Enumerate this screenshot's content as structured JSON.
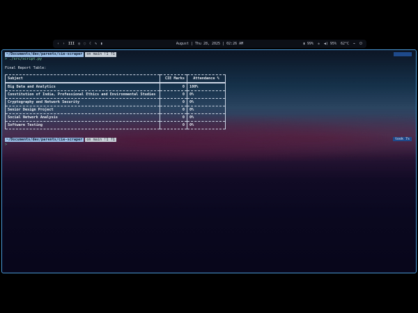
{
  "topbar": {
    "left_items": [
      "‹",
      "›",
      "III",
      "◎",
      "◌",
      "☾",
      "✎",
      "▮"
    ],
    "datetime": "August | Thu 28, 2025 | 02:26 AM",
    "right_items": [
      "▮ 99%",
      "✲",
      "◀) 95%",
      "62°C",
      "⌁",
      "⏻"
    ]
  },
  "terminal": {
    "prompt1": {
      "path": "~/Documents/dev/parents/cie-scraper",
      "git": "on main !1 ?1",
      "arrow": ">",
      "command": "./src/script.py"
    },
    "heading": "Final Report Table:",
    "table": {
      "headers": [
        "Subject",
        "CIE Marks",
        "Attendance %"
      ],
      "rows": [
        [
          "Big Data and Analytics",
          "0",
          "100%"
        ],
        [
          "Constitution of India, Professional Ethics and Environmental Studies",
          "0",
          "0%"
        ],
        [
          "Cryptography and Network Security",
          "0",
          "0%"
        ],
        [
          "Senior Design Project",
          "0",
          "0%"
        ],
        [
          "Social Network Analysis",
          "0",
          "0%"
        ],
        [
          "Software Testing",
          "0",
          "0%"
        ]
      ]
    },
    "prompt2": {
      "path": "~/Documents/dev/parents/cie-scraper",
      "git": "on main !1 ?1",
      "took": "took 7s",
      "arrow": ">"
    }
  },
  "colors": {
    "border": "#4a9ad8",
    "path_pill": "#9ec2ea",
    "git_pill": "#c9d0d8",
    "badge": "#1e4a8c",
    "prompt": "#57c79a"
  }
}
